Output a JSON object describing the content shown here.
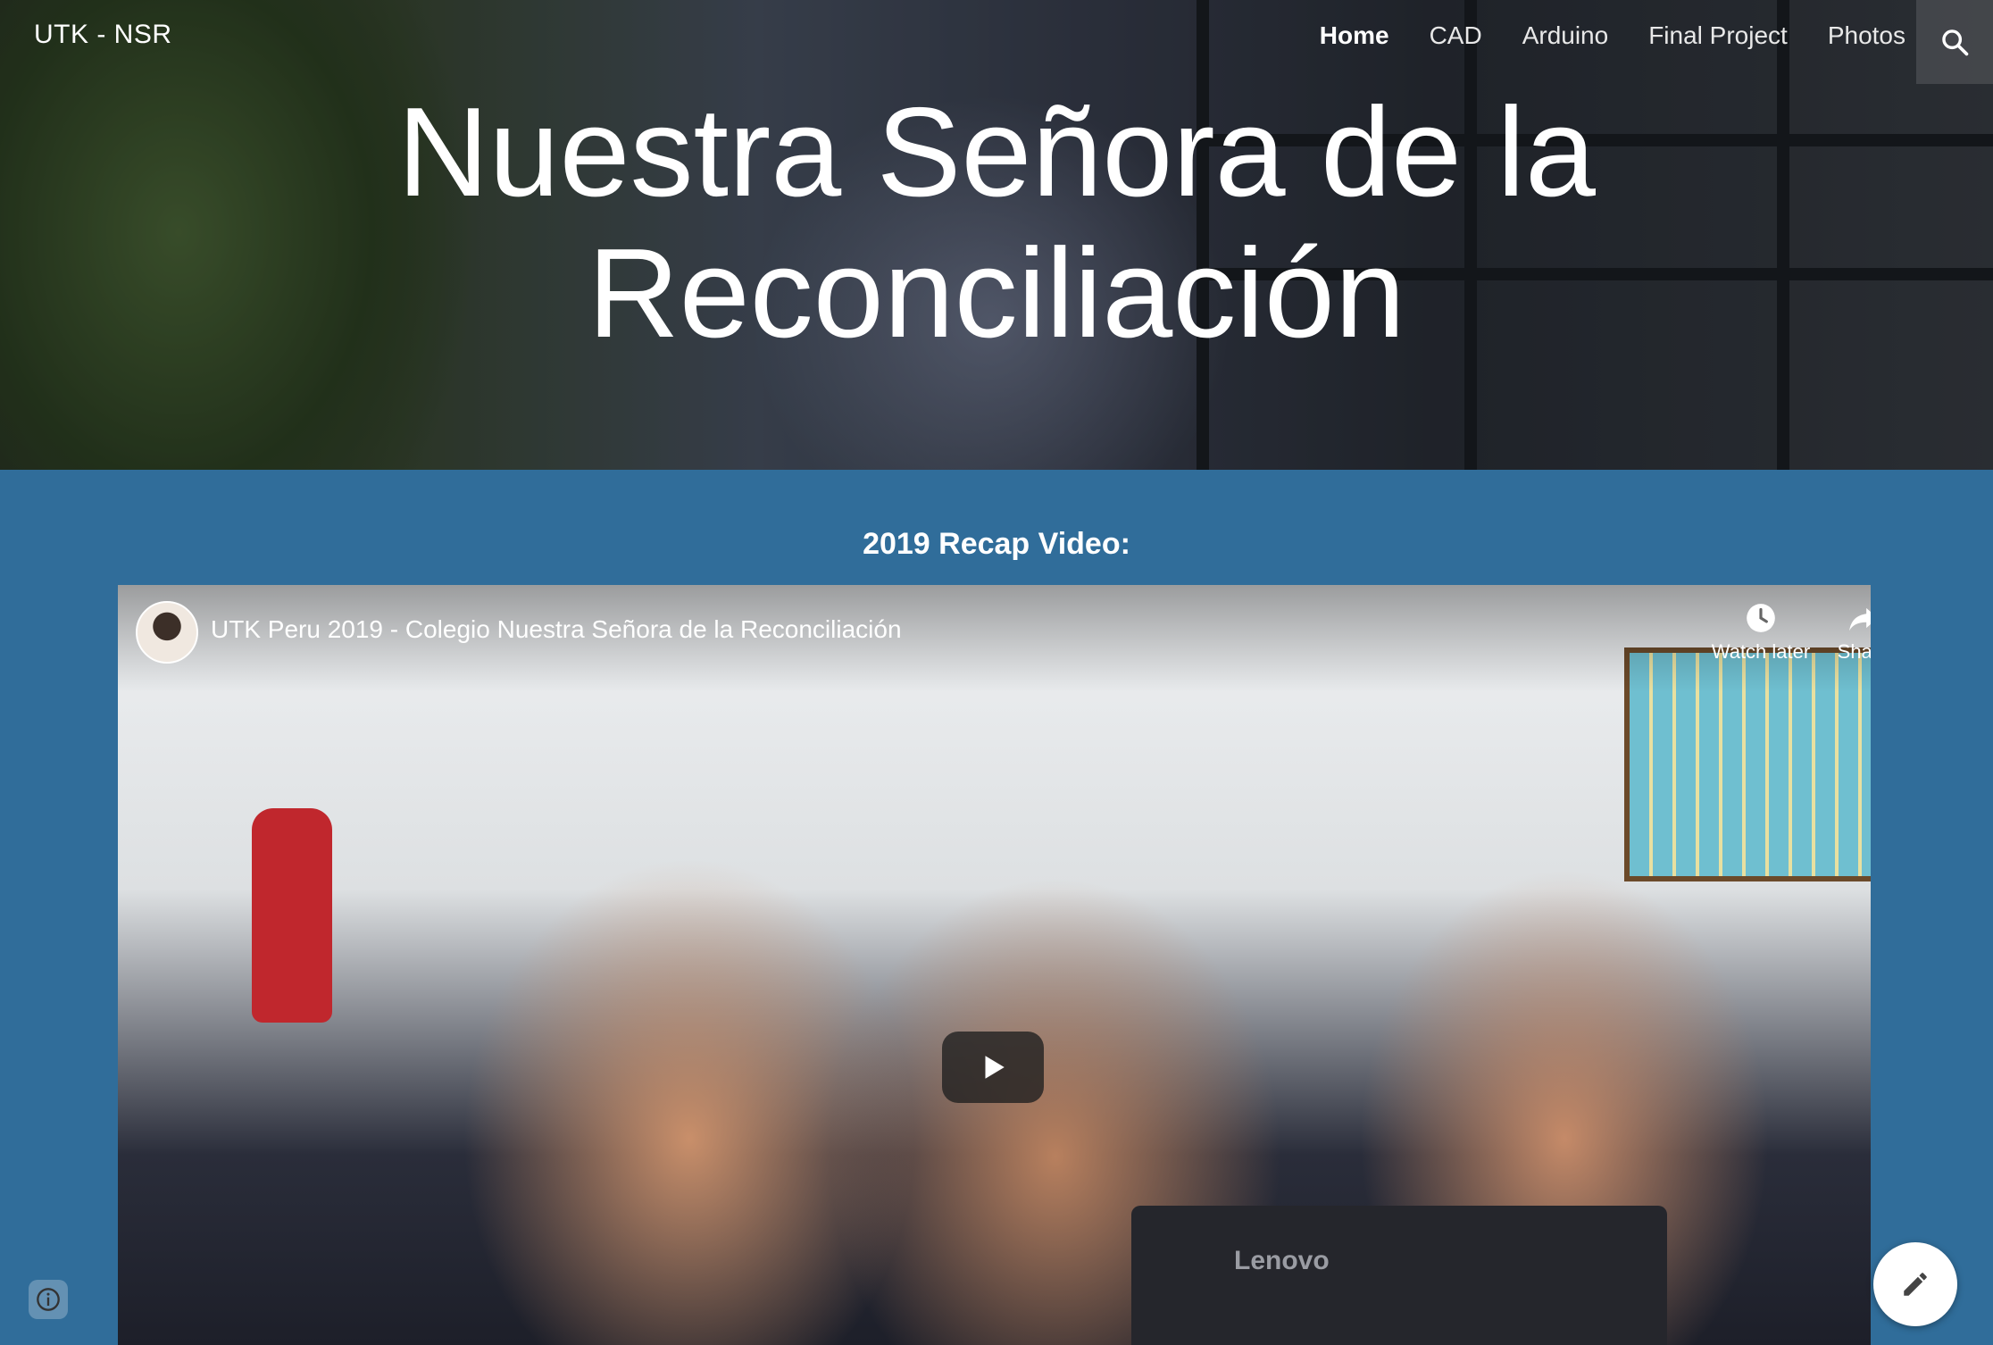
{
  "header": {
    "site_title": "UTK - NSR",
    "nav": [
      {
        "label": "Home",
        "active": true
      },
      {
        "label": "CAD",
        "active": false
      },
      {
        "label": "Arduino",
        "active": false
      },
      {
        "label": "Final Project",
        "active": false
      },
      {
        "label": "Photos",
        "active": false
      }
    ],
    "search_icon": "search-icon"
  },
  "hero": {
    "title_line1": "Nuestra Señora de la",
    "title_line2": "Reconciliación"
  },
  "main": {
    "recap_heading": "2019 Recap Video:",
    "video": {
      "title": "UTK Peru 2019 - Colegio Nuestra Señora de la Reconciliación",
      "watch_later_label": "Watch later",
      "share_label": "Share",
      "thumbnail_text": "Lenovo"
    }
  },
  "colors": {
    "section_background": "#306d9a",
    "text": "#ffffff"
  }
}
